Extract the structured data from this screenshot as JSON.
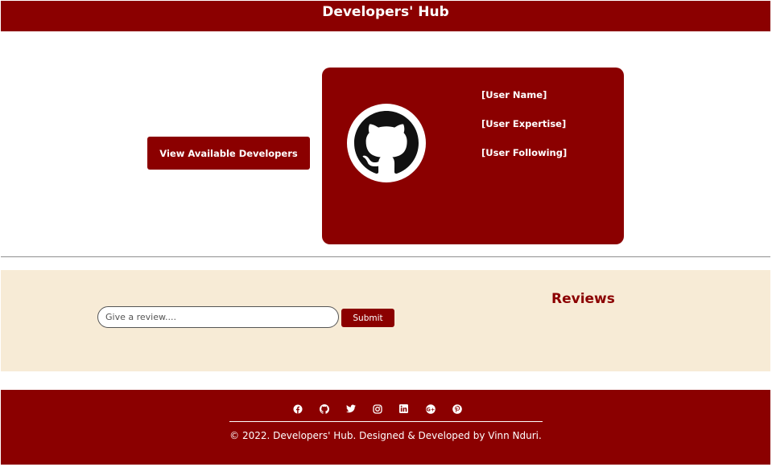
{
  "header": {
    "title": "Developers' Hub"
  },
  "main": {
    "view_button_label": "View Available Developers",
    "card": {
      "avatar_icon": "github-icon",
      "user_name": "[User Name]",
      "user_expertise": "[User Expertise]",
      "user_following": "[User Following]"
    }
  },
  "reviews": {
    "title": "Reviews",
    "input_placeholder": "Give a review....",
    "submit_label": "Submit"
  },
  "footer": {
    "social_icons": [
      "facebook-icon",
      "github-icon",
      "twitter-icon",
      "instagram-icon",
      "linkedin-icon",
      "google-plus-icon",
      "pinterest-icon"
    ],
    "copyright": "© 2022. Developers' Hub. Designed & Developed by Vinn Nduri."
  },
  "colors": {
    "brand": "#8b0000",
    "reviews_background": "#f7ebd6",
    "text_light": "#ffffff"
  }
}
